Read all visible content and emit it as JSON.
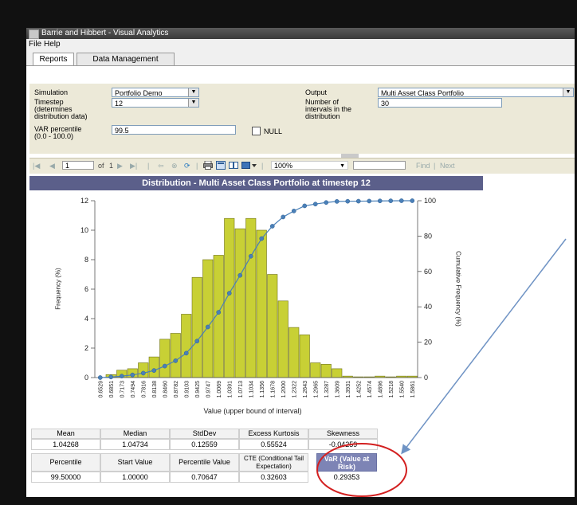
{
  "window": {
    "title": "Barrie and Hibbert - Visual Analytics"
  },
  "menu": {
    "file": "File",
    "help": "Help"
  },
  "tabs": [
    {
      "label": "Reports",
      "active": true
    },
    {
      "label": "Data Management",
      "active": false
    }
  ],
  "params": {
    "simulation_label": "Simulation",
    "simulation_value": "Portfolio Demo",
    "timestep_label": "Timestep",
    "timestep_label_2": "(determines",
    "timestep_label_3": "distribution data)",
    "timestep_value": "12",
    "var_label": "VAR percentile",
    "var_label_2": "(0.0 - 100.0)",
    "var_value": "99.5",
    "null_label": "NULL",
    "output_label": "Output",
    "output_value": "Multi Asset Class Portfolio",
    "intervals_label": "Number of",
    "intervals_label_2": "intervals in the",
    "intervals_label_3": "distribution",
    "intervals_value": "30"
  },
  "toolbar": {
    "page": "1",
    "of": "of",
    "total": "1",
    "zoom": "100%",
    "find": "Find",
    "sep": "|",
    "next": "Next"
  },
  "chart_data": {
    "type": "bar",
    "title": "Distribution - Multi Asset Class Portfolio at timestep 12",
    "xlabel": "Value (upper bound of interval)",
    "ylabel": "Frequency (%)",
    "y2label": "Cumulative Frequency (%)",
    "ylim": [
      0,
      12
    ],
    "y2lim": [
      0,
      100
    ],
    "yticks": [
      "0",
      "2",
      "4",
      "6",
      "8",
      "10",
      "12"
    ],
    "y2ticks": [
      "0",
      "20",
      "40",
      "60",
      "80",
      "100"
    ],
    "categories": [
      "0.6529",
      "0.6851",
      "0.7173",
      "0.7494",
      "0.7816",
      "0.8138",
      "0.8460",
      "0.8782",
      "0.9103",
      "0.9425",
      "0.9747",
      "1.0069",
      "1.0391",
      "1.0713",
      "1.1034",
      "1.1356",
      "1.1678",
      "1.2000",
      "1.2322",
      "1.2643",
      "1.2965",
      "1.3287",
      "1.3609",
      "1.3931",
      "1.4252",
      "1.4574",
      "1.4896",
      "1.5218",
      "1.5540",
      "1.5861"
    ],
    "series": [
      {
        "type": "bar",
        "values": [
          0.0,
          0.2,
          0.5,
          0.6,
          1.0,
          1.4,
          2.6,
          3.0,
          4.3,
          6.8,
          8.0,
          8.3,
          10.8,
          10.1,
          10.8,
          10.0,
          7.0,
          5.2,
          3.4,
          2.9,
          1.0,
          0.9,
          0.6,
          0.1,
          0.05,
          0.05,
          0.1,
          0.05,
          0.1,
          0.1
        ]
      },
      {
        "type": "line",
        "axis": "right",
        "values": [
          0.0,
          0.3,
          0.8,
          1.5,
          2.5,
          4.0,
          6.5,
          9.5,
          13.8,
          20.6,
          28.6,
          36.9,
          47.7,
          57.8,
          68.6,
          78.6,
          85.6,
          90.8,
          94.2,
          97.1,
          98.1,
          99.0,
          99.6,
          99.7,
          99.75,
          99.8,
          99.9,
          99.95,
          100.0,
          100.0
        ]
      }
    ]
  },
  "stats": {
    "headers": [
      "Mean",
      "Median",
      "StdDev",
      "Excess Kurtosis",
      "Skewness"
    ],
    "values": [
      "1.04268",
      "1.04734",
      "0.12559",
      "0.55524",
      "-0.04259"
    ],
    "headers2": [
      "Percentile",
      "Start Value",
      "Percentile Value",
      "CTE (Conditional Tail Expectation)",
      "VaR (Value at Risk)"
    ],
    "values2": [
      "99.50000",
      "1.00000",
      "0.70647",
      "0.32603",
      "0.29353"
    ]
  },
  "colors": {
    "bar": "#c8d035",
    "bar_stroke": "#6f7218",
    "line": "#4a80b8",
    "title_bg": "#5b5f8a",
    "highlight": "#d32020",
    "arrow": "#6f93c4"
  }
}
